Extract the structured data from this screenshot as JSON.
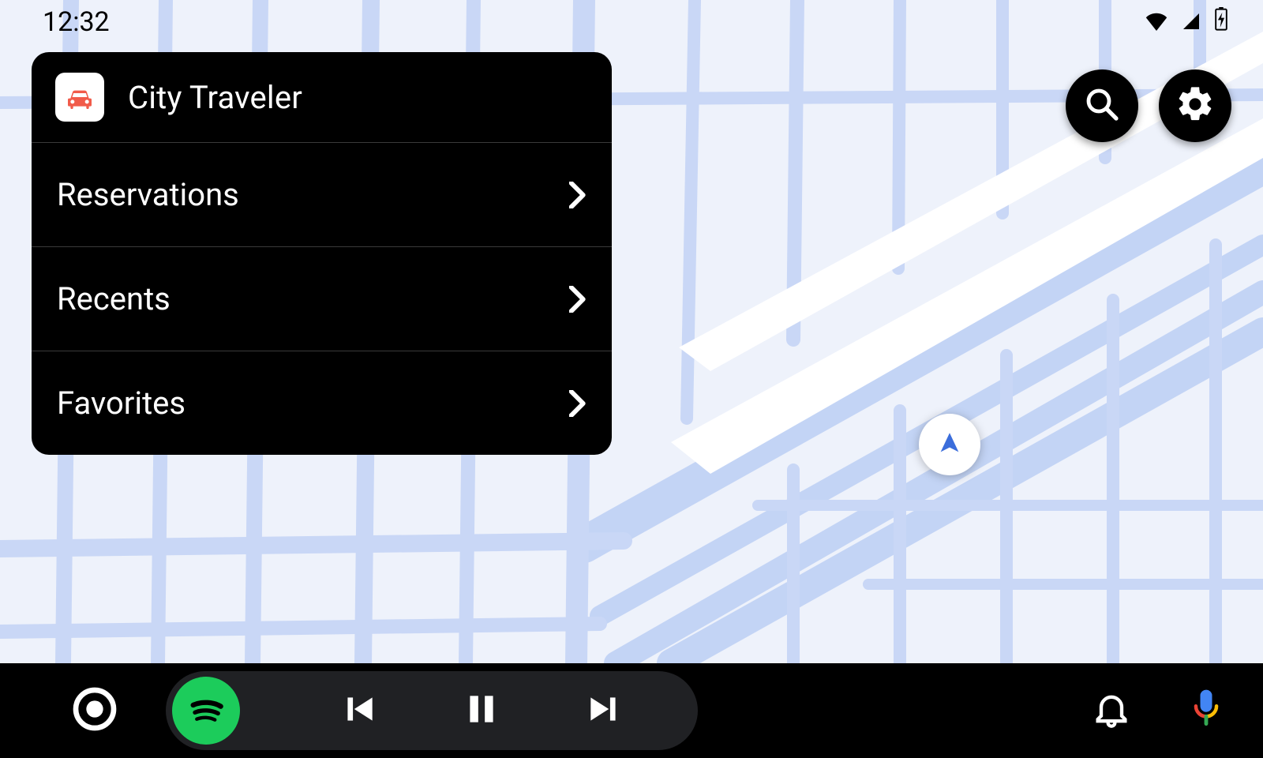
{
  "status": {
    "time": "12:32"
  },
  "panel": {
    "app_name": "City Traveler",
    "items": [
      {
        "label": "Reservations"
      },
      {
        "label": "Recents"
      },
      {
        "label": "Favorites"
      }
    ]
  },
  "actions": {
    "search_icon": "search-icon",
    "settings_icon": "gear-icon"
  },
  "bottom": {
    "media_app": "spotify",
    "home_icon": "home-circle-icon",
    "prev_icon": "skip-previous-icon",
    "play_pause_icon": "pause-icon",
    "next_icon": "skip-next-icon",
    "notification_icon": "bell-icon",
    "voice_icon": "microphone-icon"
  },
  "colors": {
    "accent_app": "#F15B4A",
    "media_app": "#1CCC5B",
    "map_roads": "#c3d4f5",
    "heading_blue": "#3b6ddb"
  }
}
